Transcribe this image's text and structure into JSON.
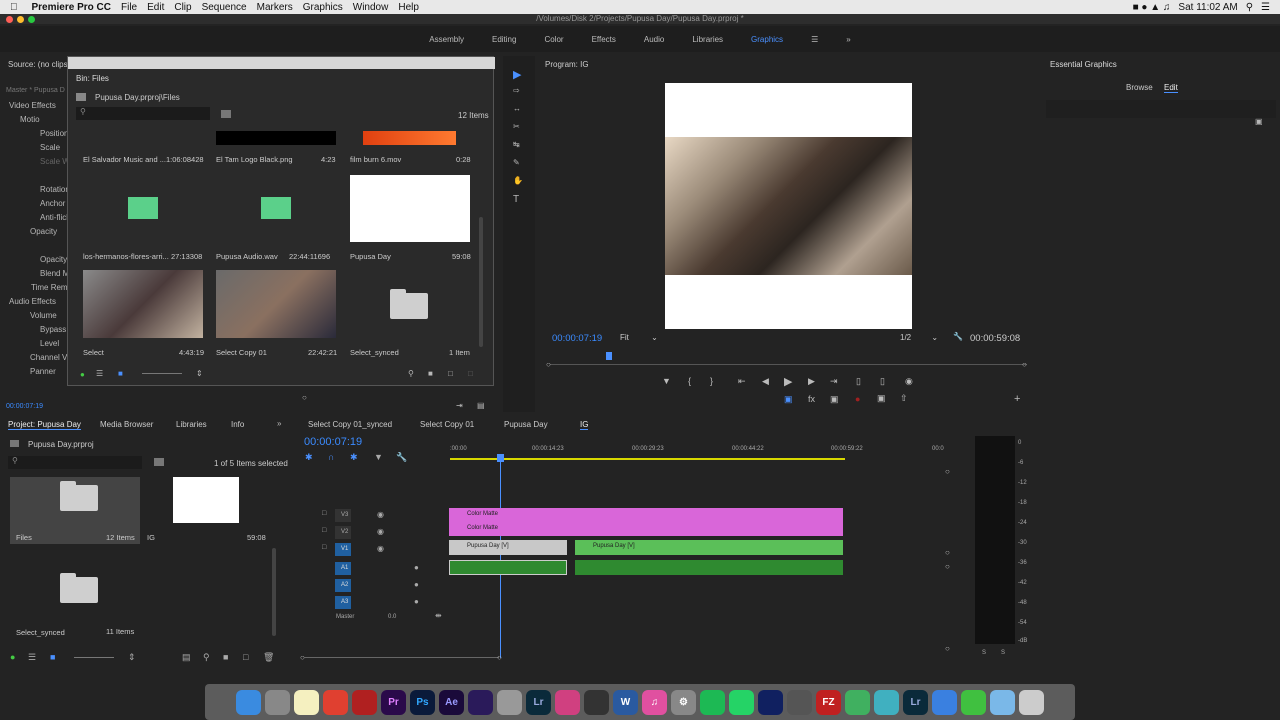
{
  "menubar": {
    "apple": "",
    "app": "Premiere Pro CC",
    "items": [
      "File",
      "Edit",
      "Clip",
      "Sequence",
      "Markers",
      "Graphics",
      "Window",
      "Help"
    ],
    "clock": "Sat 11:02 AM"
  },
  "titlebar": {
    "path": "/Volumes/Disk 2/Projects/Pupusa Day/Pupusa Day.prproj *"
  },
  "workspaces": {
    "items": [
      "Assembly",
      "Editing",
      "Color",
      "Effects",
      "Audio",
      "Libraries",
      "Graphics"
    ],
    "active": "Graphics",
    "more": "»"
  },
  "source_panel": {
    "title": "Source: (no clips)",
    "master": "Master * Pupusa D",
    "video_effects": "Video Effects",
    "audio_effects": "Audio Effects",
    "rows": [
      "Motio",
      "Position",
      "Scale",
      "Scale Wi",
      "Rotation",
      "Anchor P",
      "Anti-flick",
      "Opacity",
      "Opacity",
      "Blend M",
      "Time Rema",
      "Volume",
      "Bypass",
      "Level",
      "Channel Vo",
      "Panner"
    ],
    "timecode": "00:00:07:19"
  },
  "bin": {
    "title": "Bin: Files",
    "path": "Pupusa Day.prproj\\Files",
    "count": "12 Items",
    "items": [
      {
        "name": "El Salvador Music and ...",
        "dur": "1:06:08428"
      },
      {
        "name": "El Tam Logo Black.png",
        "dur": "4:23"
      },
      {
        "name": "film burn 6.mov",
        "dur": "0:28"
      },
      {
        "name": "los-hermanos-flores-arri...",
        "dur": "27:13308"
      },
      {
        "name": "Pupusa Audio.wav",
        "dur": "22:44:11696"
      },
      {
        "name": "Pupusa Day",
        "dur": "59:08"
      },
      {
        "name": "Select",
        "dur": "4:43:19"
      },
      {
        "name": "Select Copy 01",
        "dur": "22:42:21"
      },
      {
        "name": "Select_synced",
        "dur": "1 Item"
      }
    ]
  },
  "program": {
    "title": "Program: IG",
    "timecode": "00:00:07:19",
    "fit": "Fit",
    "resolution": "1/2",
    "duration": "00:00:59:08"
  },
  "essential_graphics": {
    "title": "Essential Graphics",
    "tabs": [
      "Browse",
      "Edit"
    ],
    "active": "Edit"
  },
  "project": {
    "tabs": [
      "Project: Pupusa Day",
      "Media Browser",
      "Libraries",
      "Info"
    ],
    "name": "Pupusa Day.prproj",
    "selected": "1 of 5 Items selected",
    "items": [
      {
        "name": "Files",
        "count": "12 Items"
      },
      {
        "name": "IG",
        "count": "59:08"
      },
      {
        "name": "Select_synced",
        "count": "11 Items"
      }
    ]
  },
  "timeline": {
    "tabs": [
      "Select Copy 01_synced",
      "Select Copy 01",
      "Pupusa Day",
      "IG"
    ],
    "timecode": "00:00:07:19",
    "ruler": [
      ":00:00",
      "00:00:14:23",
      "00:00:29:23",
      "00:00:44:22",
      "00:00:59:22",
      "00:0"
    ],
    "video_tracks": [
      "V3",
      "V2",
      "V1"
    ],
    "audio_tracks": [
      "A1",
      "A2",
      "A3"
    ],
    "master_label": "Master",
    "master_value": "0.0",
    "clips": {
      "v3": "Color Matte",
      "v2": "Color Matte",
      "v1a": "Pupusa Day [V]",
      "v1b": "Pupusa Day [V]"
    },
    "meter_ticks": [
      "0",
      "-6",
      "-12",
      "-18",
      "-24",
      "-30",
      "-36",
      "-42",
      "-48",
      "-54",
      "-dB"
    ],
    "solo": [
      "S",
      "S"
    ]
  },
  "dock": [
    "Finder",
    "Launchpad",
    "Notes",
    "Chrome",
    "Davinci",
    "Pr",
    "Ps",
    "Ae",
    "Ai",
    "Automator",
    "Lr",
    "Resolve",
    "FCP",
    "Word",
    "iTunes",
    "Sys",
    "Spotify",
    "WhatsApp",
    "Avery",
    "Evernote",
    "FZ",
    "Atom",
    "React",
    "Lr",
    "Zoom",
    "Camo",
    "Folder",
    "Trash"
  ]
}
